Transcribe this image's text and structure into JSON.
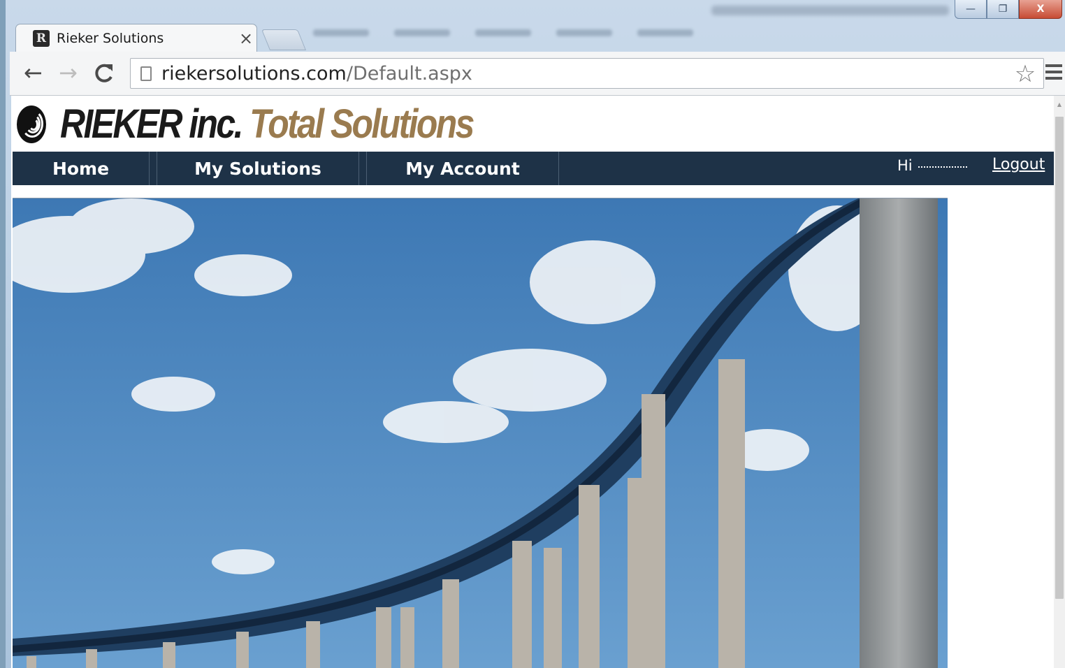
{
  "browser": {
    "tab": {
      "title": "Rieker Solutions",
      "favicon": "R",
      "close_glyph": "×"
    },
    "window_buttons": {
      "minimize": "—",
      "maximize": "❐",
      "close": "X"
    },
    "nav": {
      "back_glyph": "←",
      "forward_glyph": "→",
      "reload_glyph": "C"
    },
    "address": {
      "domain": "riekersolutions.com",
      "path": "/Default.aspx"
    },
    "star_glyph": "☆"
  },
  "site": {
    "brand": {
      "part1": "RIEKER inc.",
      "part2": "Total Solutions",
      "color_primary": "#1a1a1a",
      "color_accent": "#9a7b4f"
    },
    "nav": {
      "items": [
        {
          "label": "Home"
        },
        {
          "label": "My Solutions"
        },
        {
          "label": "My Account"
        }
      ],
      "greeting": "Hi",
      "logout": "Logout",
      "background": "#1e3247"
    }
  }
}
